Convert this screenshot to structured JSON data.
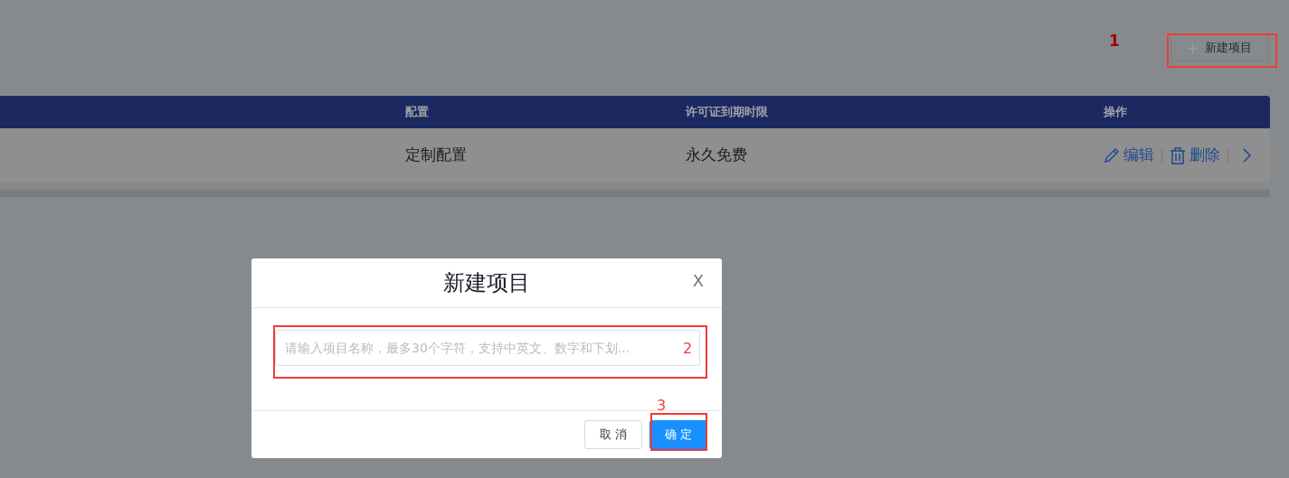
{
  "toolbar": {
    "new_button": {
      "label": "新建项目"
    }
  },
  "table": {
    "columns": [
      "配置",
      "许可证到期时限",
      "操作"
    ],
    "rows": [
      {
        "cells": [
          "定制配置",
          "永久免费"
        ],
        "actions": [
          {
            "kind": "edit",
            "label": "编辑"
          },
          {
            "kind": "delete",
            "label": "删除"
          },
          {
            "kind": "more"
          }
        ]
      }
    ]
  },
  "dialog": {
    "title": "新建项目",
    "close": "X",
    "field": {
      "placeholder": "请输入项目名称，最多30个字符，支持中英文、数字和下划..."
    },
    "buttons": [
      {
        "kind": "cancel",
        "label": "取 消"
      },
      {
        "kind": "ok",
        "label": "确 定"
      }
    ]
  },
  "annotations": [
    {
      "number": "1"
    },
    {
      "number": "2"
    },
    {
      "number": "3"
    }
  ]
}
